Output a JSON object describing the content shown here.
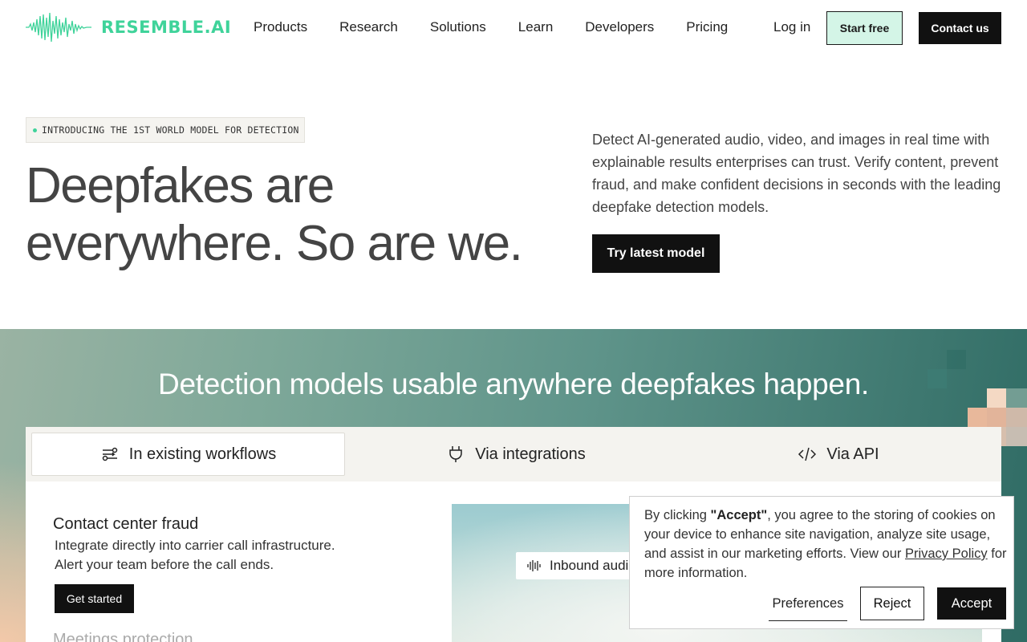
{
  "brand": {
    "name": "RESEMBLE.AI",
    "accent": "#3fd39a"
  },
  "nav": {
    "items": [
      "Products",
      "Research",
      "Solutions",
      "Learn",
      "Developers",
      "Pricing"
    ],
    "login": "Log in",
    "start_free": "Start free",
    "contact": "Contact us"
  },
  "hero": {
    "badge": "INTRODUCING THE 1ST WORLD MODEL FOR DETECTION",
    "title_line1": "Deepfakes are",
    "title_line2": "everywhere. So are we.",
    "description": "Detect AI-generated audio, video, and images in real time with explainable results enterprises can trust. Verify content, prevent fraud, and make confident decisions in seconds with the leading deepfake detection models.",
    "cta": "Try latest model"
  },
  "detection": {
    "title": "Detection models usable anywhere deepfakes happen.",
    "tabs": [
      {
        "label": "In existing workflows",
        "icon": "workflow-icon",
        "active": true
      },
      {
        "label": "Via integrations",
        "icon": "plug-icon",
        "active": false
      },
      {
        "label": "Via API",
        "icon": "code-icon",
        "active": false
      }
    ],
    "use_case": {
      "title": "Contact center fraud",
      "line1": "Integrate directly into carrier call infrastructure.",
      "line2": "Alert your team before the call ends.",
      "cta": "Get started"
    },
    "next_use_case": "Meetings protection",
    "media_chip": "Inbound audio"
  },
  "cookie": {
    "prefix": "By clicking ",
    "accept_quote": "\"Accept\"",
    "middle": ", you agree to the storing of cookies on your device to enhance site navigation, analyze site usage, and assist in our marketing efforts. View our ",
    "link": "Privacy Policy",
    "suffix": " for more information.",
    "preferences": "Preferences",
    "reject": "Reject",
    "accept": "Accept"
  }
}
